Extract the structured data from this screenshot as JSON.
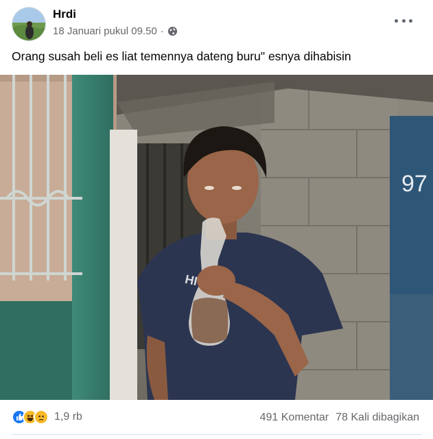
{
  "post": {
    "author": "Hrdi",
    "date": "18 Januari pukul 09.50",
    "separator": "·",
    "caption": "Orang susah beli es liat temennya dateng buru\" esnya dihabisin",
    "privacy_icon": "globe-icon",
    "menu_icon": "more-options-icon"
  },
  "photo": {
    "wall_number": "97",
    "shirt_text": "HI 65"
  },
  "engagement": {
    "reaction_icons": [
      "like-icon",
      "haha-icon",
      "sad-icon"
    ],
    "reaction_count": "1,9 rb",
    "comments": "491 Komentar",
    "shares": "78 Kali dibagikan"
  },
  "colors": {
    "like": "#1877f2",
    "haha": "#f7b928",
    "muted_text": "#65676b"
  }
}
